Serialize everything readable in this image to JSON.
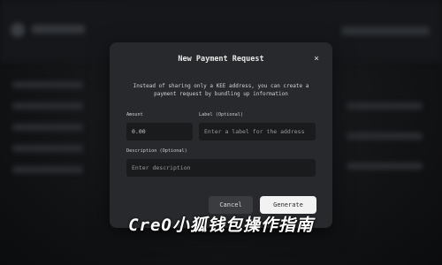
{
  "modal": {
    "title": "New Payment Request",
    "close_icon": "×",
    "description": "Instead of sharing only a KEE address, you can create a payment request by bundling up information",
    "amount_label": "Amount",
    "amount_value": "0.00",
    "label_label": "Label (Optional)",
    "label_placeholder": "Enter a label for the address",
    "description_label": "Description (Optional)",
    "description_placeholder": "Enter description",
    "cancel_label": "Cancel",
    "generate_label": "Generate"
  },
  "caption": "CreO小狐钱包操作指南",
  "colors": {
    "background": "#121315",
    "modal": "#27292c",
    "field": "#1a1b1d",
    "primary_button": "#f2f2f2"
  }
}
